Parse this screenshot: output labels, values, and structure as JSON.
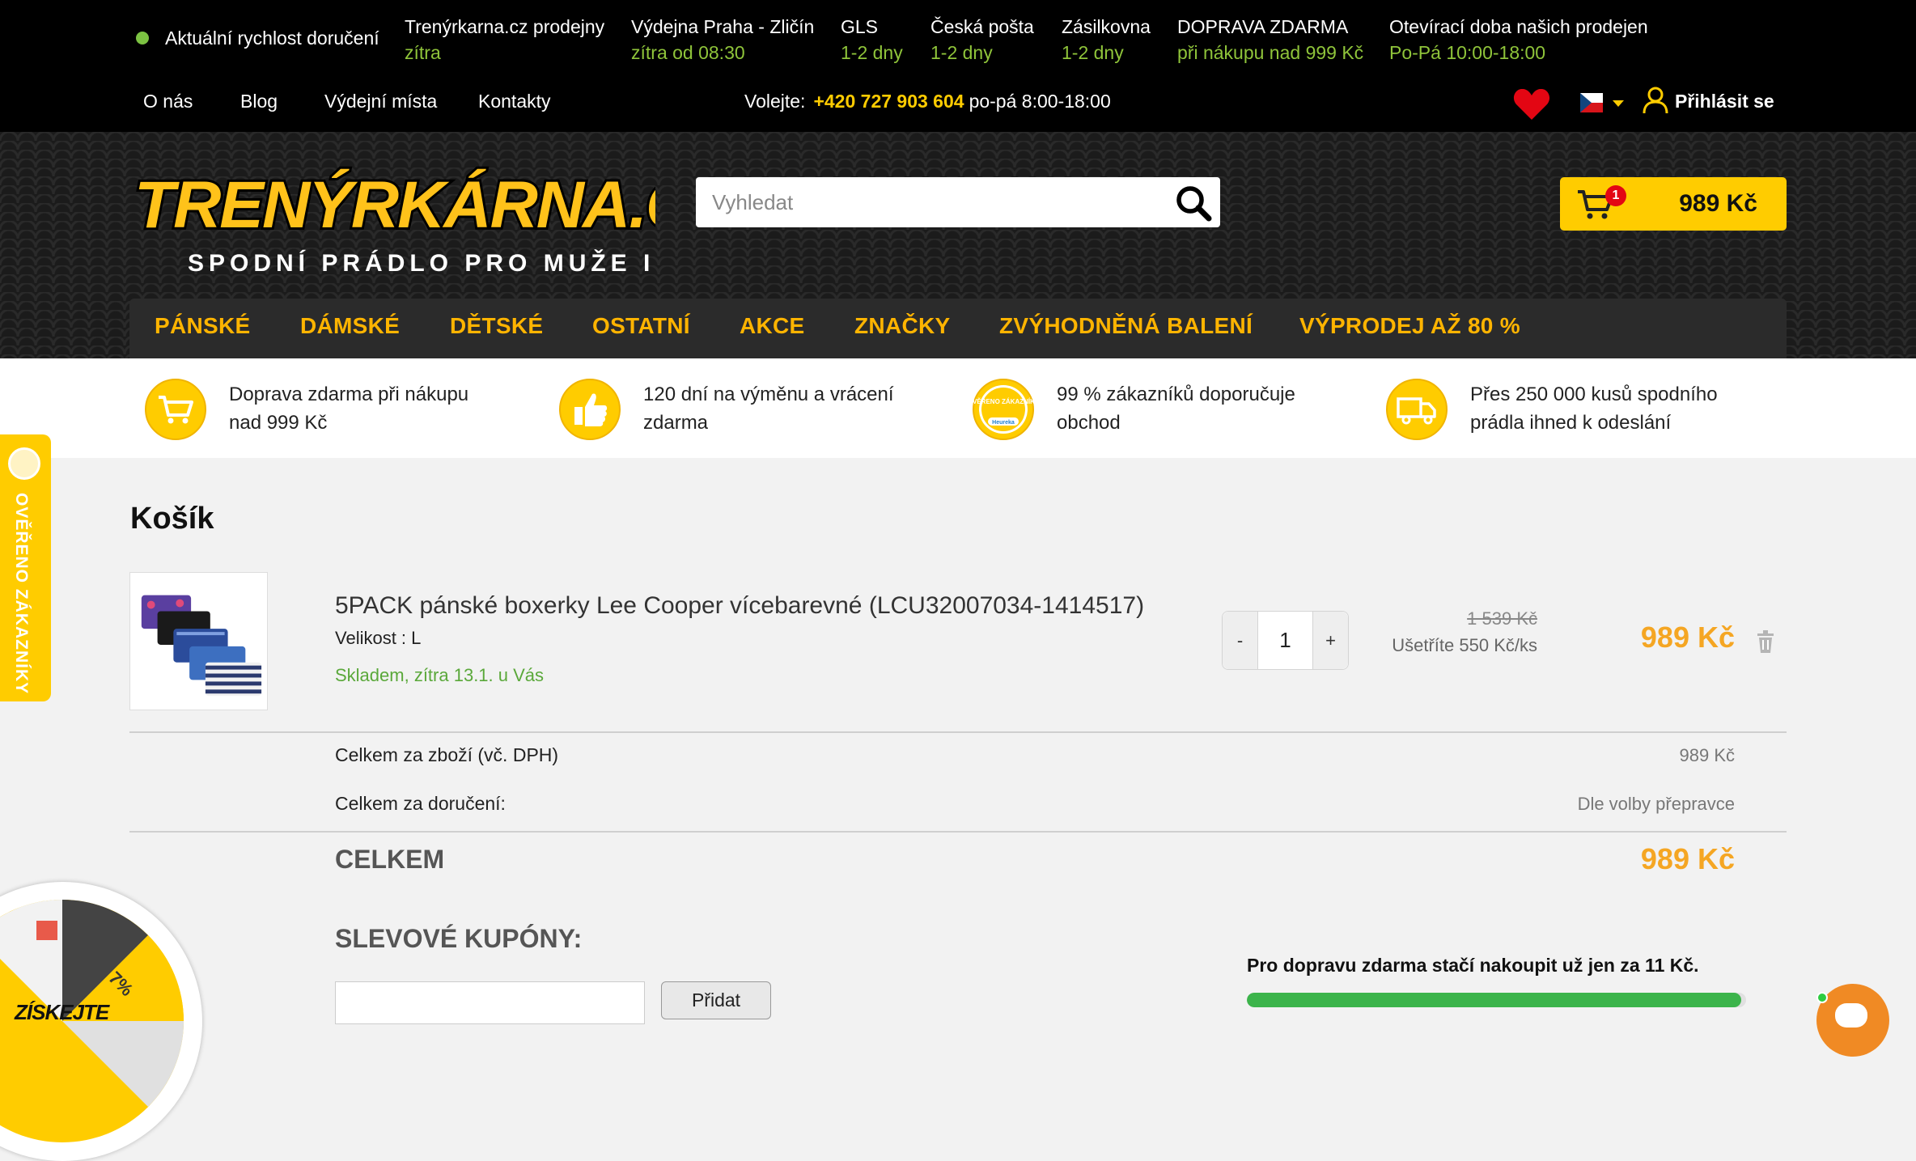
{
  "delivery_bar": {
    "label": "Aktuální rychlost doručení",
    "items": [
      {
        "title": "Trenýrkarna.cz prodejny",
        "sub": "zítra"
      },
      {
        "title": "Výdejna Praha - Zličín",
        "sub": "zítra od 08:30"
      },
      {
        "title": "GLS",
        "sub": "1-2 dny"
      },
      {
        "title": "Česká pošta",
        "sub": "1-2 dny"
      },
      {
        "title": "Zásilkovna",
        "sub": "1-2 dny"
      },
      {
        "title": "DOPRAVA ZDARMA",
        "sub": "při nákupu nad 999 Kč"
      },
      {
        "title": "Otevírací doba našich prodejen",
        "sub": "Po-Pá 10:00-18:00"
      }
    ]
  },
  "top_nav": {
    "links": [
      "O nás",
      "Blog",
      "Výdejní místa",
      "Kontakty"
    ],
    "call_label": "Volejte:",
    "phone": "+420 727 903 604",
    "hours": "po-pá 8:00-18:00",
    "login": "Přihlásit se"
  },
  "header": {
    "logo_text": "TRENÝRKÁRNA.CZ",
    "logo_tagline": "SPODNÍ PRÁDLO PRO MUŽE I ŽENY",
    "search_placeholder": "Vyhledat",
    "cart_count": "1",
    "cart_total": "989 Kč"
  },
  "main_nav": [
    "PÁNSKÉ",
    "DÁMSKÉ",
    "DĚTSKÉ",
    "OSTATNÍ",
    "AKCE",
    "ZNAČKY",
    "ZVÝHODNĚNÁ BALENÍ",
    "VÝPRODEJ AŽ 80 %"
  ],
  "benefits": [
    {
      "icon": "cart-icon",
      "line1": "Doprava zdarma při nákupu",
      "line2": "nad 999 Kč"
    },
    {
      "icon": "thumbs-up-icon",
      "line1": "120 dní na výměnu a vrácení",
      "line2": "zdarma"
    },
    {
      "icon": "heureka-badge-icon",
      "line1": "99 % zákazníků doporučuje",
      "line2": "obchod",
      "badge_text": "OVĚŘENO ZÁKAZNÍKY",
      "badge_brand": "Heureka"
    },
    {
      "icon": "delivery-truck-icon",
      "line1": "Přes 250 000 kusů spodního",
      "line2": "prádla ihned k odeslání"
    }
  ],
  "side_widget": {
    "label": "OVĚŘENO ZÁKAZNÍKY"
  },
  "cart": {
    "title": "Košík",
    "item": {
      "name": "5PACK pánské boxerky Lee Cooper vícebarevné (LCU32007034-1414517)",
      "size": "Velikost : L",
      "stock": "Skladem, zítra 13.1. u Vás",
      "qty": "1",
      "qty_minus": "-",
      "qty_plus": "+",
      "old_price": "1 539 Kč",
      "savings": "Ušetříte 550 Kč/ks",
      "price": "989 Kč"
    },
    "goods_total_label": "Celkem za zboží (vč. DPH)",
    "goods_total_value": "989 Kč",
    "delivery_label": "Celkem za doručení:",
    "delivery_value": "Dle volby přepravce",
    "total_label": "CELKEM",
    "total_value": "989 Kč",
    "coupon_title": "SLEVOVÉ KUPÓNY:",
    "coupon_button": "Přidat",
    "free_shipping_text": "Pro dopravu zdarma stačí nakoupit už jen za 11 Kč.",
    "free_shipping_progress": 0.99
  },
  "promo_wheel": {
    "label": "ZÍSKEJTE",
    "segment_label": "7%"
  },
  "colors": {
    "accent": "#ffcc00",
    "price": "#f5a623",
    "green": "#5aa83a",
    "progress": "#3cb44b"
  }
}
